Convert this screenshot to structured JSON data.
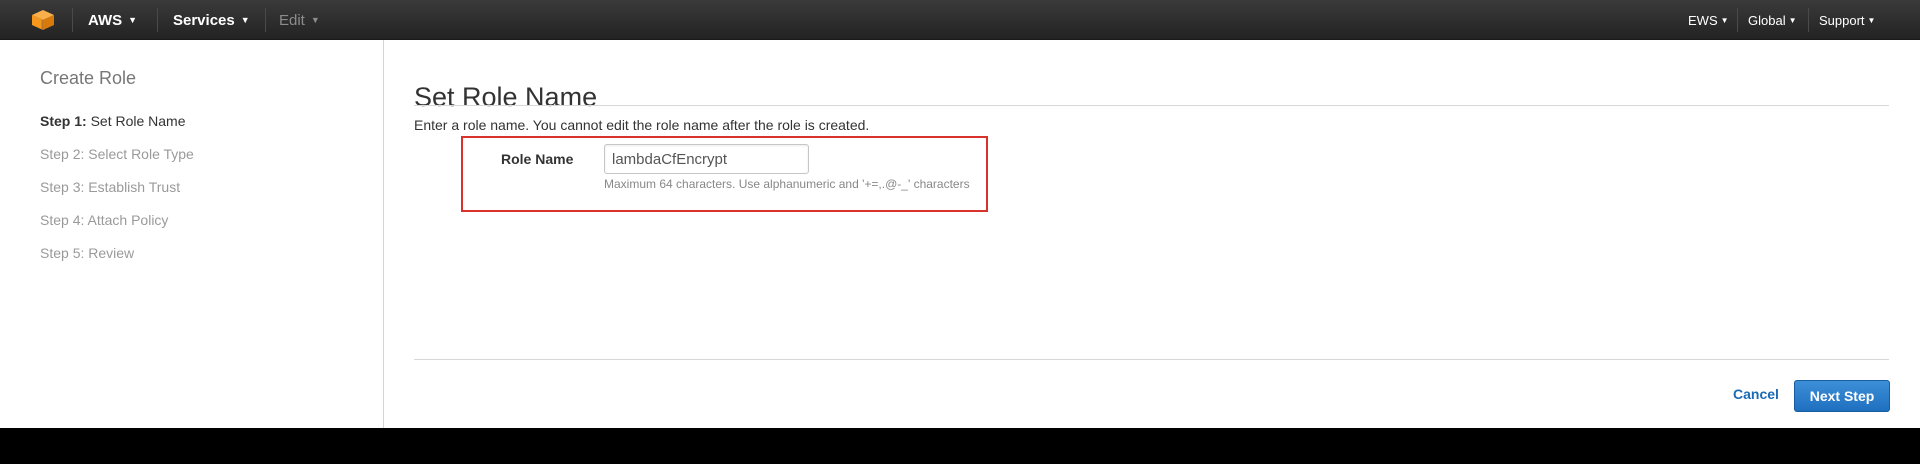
{
  "topnav": {
    "brand": "AWS",
    "services": "Services",
    "edit": "Edit",
    "account": "EWS",
    "region": "Global",
    "support": "Support",
    "logo_icon": "aws-cube-icon",
    "caret_icon": "caret-down-icon"
  },
  "sidebar": {
    "title": "Create Role",
    "steps": [
      {
        "number": "Step 1:",
        "label": "Set Role Name",
        "active": true
      },
      {
        "number": "Step 2:",
        "label": "Select Role Type",
        "active": false
      },
      {
        "number": "Step 3:",
        "label": "Establish Trust",
        "active": false
      },
      {
        "number": "Step 4:",
        "label": "Attach Policy",
        "active": false
      },
      {
        "number": "Step 5:",
        "label": "Review",
        "active": false
      }
    ]
  },
  "main": {
    "title": "Set Role Name",
    "description": "Enter a role name. You cannot edit the role name after the role is created.",
    "field_label": "Role Name",
    "field_value": "lambdaCfEncrypt",
    "help_text": "Maximum 64 characters. Use alphanumeric and '+=,.@-_' characters",
    "cancel_label": "Cancel",
    "next_label": "Next Step"
  },
  "colors": {
    "nav_bg": "#2d2d2d",
    "logo_orange": "#f7981d",
    "highlight_border": "#d9312b",
    "link_blue": "#1a6bb4",
    "primary_button": "#2a7dce"
  }
}
